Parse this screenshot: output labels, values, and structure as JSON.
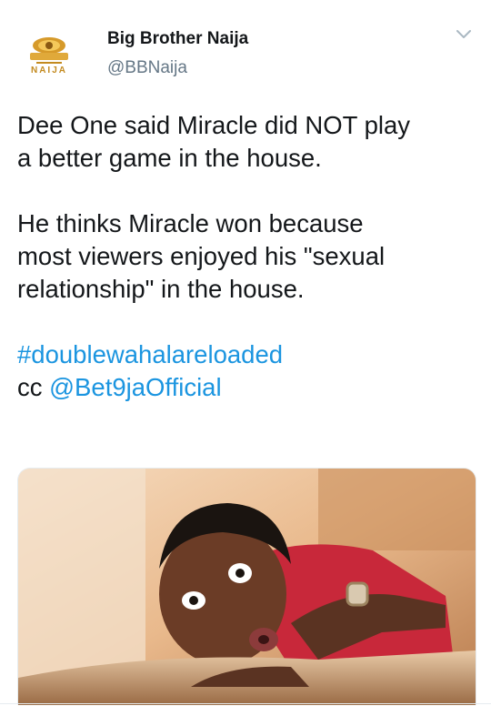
{
  "account": {
    "display_name": "Big Brother Naija",
    "handle": "@BBNaija",
    "avatar_logo_text": "NAIJA"
  },
  "tweet": {
    "line1": "Dee One said Miracle did NOT play",
    "line2": "a better game in the house.",
    "line3": "He thinks Miracle won because",
    "line4": "most viewers enjoyed his \"sexual",
    "line5": "relationship\" in the house.",
    "hashtag": "#doublewahalareloaded",
    "cc_prefix": "cc ",
    "mention": "@Bet9jaOfficial"
  },
  "icons": {
    "menu": "chevron-down-icon"
  },
  "colors": {
    "link": "#1b95e0",
    "text": "#14171a",
    "secondary": "#657786"
  }
}
